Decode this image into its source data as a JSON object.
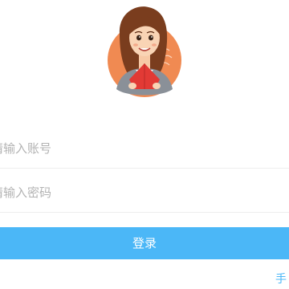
{
  "login_form": {
    "account_placeholder": "请输入账号",
    "account_value": "",
    "password_placeholder": "请输入密码",
    "password_value": "",
    "submit_label": "登录",
    "bottom_link_label": "手"
  },
  "colors": {
    "accent": "#4bb7f7",
    "placeholder_text": "#b3b3b3",
    "avatar_background": "#f08a52",
    "divider": "#ededed"
  },
  "icons": {
    "avatar": "woman-avatar-illustration"
  }
}
